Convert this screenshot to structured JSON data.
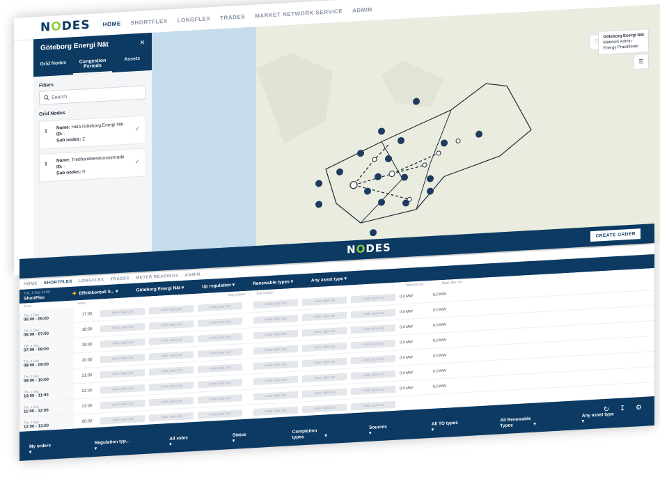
{
  "brand": {
    "name_pre": "N",
    "name_o": "O",
    "name_post": "DES"
  },
  "top": {
    "nav": [
      "HOME",
      "SHORTFLEX",
      "LONGFLEX",
      "TRADES",
      "MARKET NETWORK SERVICE",
      "ADMIN"
    ],
    "panel": {
      "title": "Göteborg Energi Nät",
      "close": "×",
      "tabs": [
        "Grid Nodes",
        "Congestion Periods",
        "Assets"
      ],
      "filters_label": "Filters",
      "search_placeholder": "Search",
      "search_icon": "magnifier-icon",
      "grid_nodes_label": "Grid Nodes",
      "nodes": [
        {
          "num": "1",
          "name_label": "Name:",
          "name": "Hela Göteborg Energi Nät",
          "id_label": "ID:",
          "id": "-",
          "sub_label": "Sub nodes:",
          "sub": "2",
          "check": "✓"
        },
        {
          "num": "1",
          "name_label": "Name:",
          "name": "Tredhaneberskonsomrade",
          "id_label": "ID:",
          "id": "-",
          "sub_label": "Sub nodes:",
          "sub": "0",
          "check": "✓"
        }
      ]
    },
    "map_account": {
      "name": "Göteborg Energi Nät",
      "line2": "Maintain Admin",
      "line3": "Energy Practitioner"
    },
    "bell_icon": "bell-icon",
    "layers_icon": "layers-icon"
  },
  "bottom": {
    "nav": [
      "HOME",
      "SHORTFLEX",
      "LONGFLEX",
      "TRADES",
      "METER READINGS",
      "ADMIN"
    ],
    "create_order": "CREATE ORDER",
    "header": {
      "date": "Tue, 1 Dec 22:00",
      "title": "ShortFlex"
    },
    "filters": [
      "Effektkontoll S...",
      "Göteborg Energi Nät",
      "Up regulation",
      "Renewable types",
      "Any asset type"
    ],
    "filter_arrow": "▾",
    "sub_labels": {
      "time": "Time",
      "hour": "Hour",
      "bids": "Buy orders",
      "asks": "Sell orders",
      "vol1": "Total bid vol",
      "vol2": "Total offer vol"
    },
    "rows": [
      {
        "date": "Thu, 1 Sep",
        "time": "05:00 - 06:00",
        "hour": "17:00",
        "mw1": "0.0 MW",
        "mw2": "0.0 MW"
      },
      {
        "date": "Thu, 1 Sep",
        "time": "06:00 - 07:00",
        "hour": "18:00",
        "mw1": "0.0 MW",
        "mw2": "0.0 MW"
      },
      {
        "date": "Thu, 1 Sep",
        "time": "07:00 - 08:00",
        "hour": "19:00",
        "mw1": "0.0 MW",
        "mw2": "0.0 MW"
      },
      {
        "date": "Thu, 1 Sep",
        "time": "08:00 - 09:00",
        "hour": "20:00",
        "mw1": "0.0 MW",
        "mw2": "0.0 MW"
      },
      {
        "date": "Thu, 1 Sep",
        "time": "09:00 - 10:00",
        "hour": "21:00",
        "mw1": "0.0 MW",
        "mw2": "0.0 MW"
      },
      {
        "date": "Thu, 1 Sep",
        "time": "10:00 - 11:00",
        "hour": "22:00",
        "mw1": "0.0 MW",
        "mw2": "0.0 MW"
      },
      {
        "date": "Thu, 1 Sep",
        "time": "11:00 - 12:00",
        "hour": "23:00",
        "mw1": "0.0 MW",
        "mw2": "0.0 MW"
      },
      {
        "date": "Thu, 1 Sep",
        "time": "12:00 - 13:00",
        "hour": "00:00",
        "mw1": "",
        "mw2": ""
      }
    ],
    "cell_text": "0 MW | SEK 0.00",
    "bottom_filters": [
      "My orders",
      "Regulation typ...",
      "All sides",
      "Status",
      "Completion types",
      "Sources",
      "All TO types",
      "All Renewable Types",
      "Any asset type"
    ],
    "icons": [
      "refresh-icon",
      "download-icon",
      "settings-icon"
    ]
  }
}
